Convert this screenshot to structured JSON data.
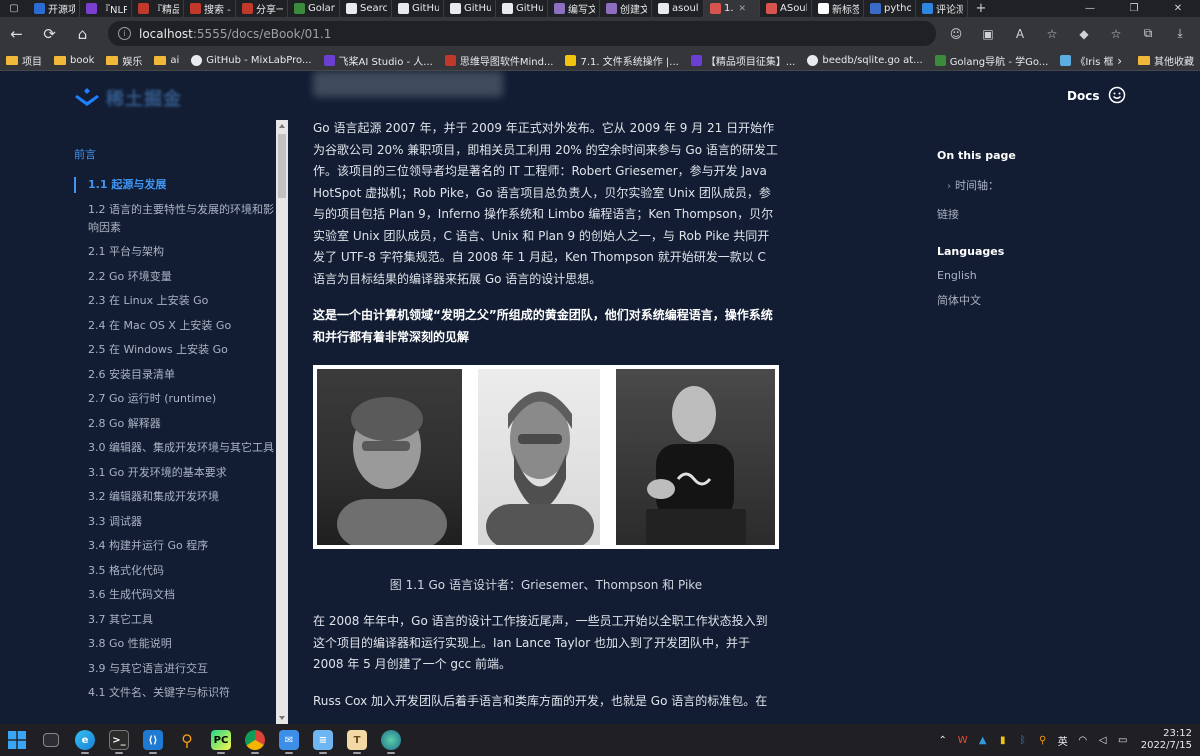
{
  "browser": {
    "tabs": [
      {
        "title": "开源项",
        "color": "#2b6cd4"
      },
      {
        "title": "『NLP",
        "color": "#7a3fd0"
      },
      {
        "title": "『精品",
        "color": "#c0392b"
      },
      {
        "title": "搜索 -",
        "color": "#c0392b"
      },
      {
        "title": "分享一",
        "color": "#c0392b"
      },
      {
        "title": "Golang",
        "color": "#3c8b3c"
      },
      {
        "title": "Search",
        "color": "#e8eaed"
      },
      {
        "title": "GitHub",
        "color": "#e8eaed"
      },
      {
        "title": "GitHub",
        "color": "#e8eaed"
      },
      {
        "title": "GitHub",
        "color": "#e8eaed"
      },
      {
        "title": "编写文",
        "color": "#8e6fbf"
      },
      {
        "title": "创建文",
        "color": "#8e6fbf"
      },
      {
        "title": "asoul",
        "color": "#e8eaed"
      },
      {
        "title": "1.",
        "color": "#d9534f"
      },
      {
        "title": "ASoul",
        "color": "#d9534f"
      },
      {
        "title": "新标签",
        "color": "#ffffff"
      },
      {
        "title": "python",
        "color": "#3b6bc9"
      },
      {
        "title": "评论测",
        "color": "#2e86de"
      }
    ],
    "url_host": "localhost",
    "url_path": ":5555/docs/eBook/01.1",
    "bookmarks": [
      {
        "label": "项目",
        "type": "folder"
      },
      {
        "label": "book",
        "type": "folder"
      },
      {
        "label": "娱乐",
        "type": "folder"
      },
      {
        "label": "ai",
        "type": "folder"
      },
      {
        "label": "GitHub - MixLabPro...",
        "type": "gh"
      },
      {
        "label": "飞桨AI Studio - 人...",
        "type": "sq",
        "color": "#6a3fd1"
      },
      {
        "label": "思维导图软件Mind...",
        "type": "sq",
        "color": "#c0392b"
      },
      {
        "label": "7.1. 文件系统操作 |...",
        "type": "sq",
        "color": "#f1c40f"
      },
      {
        "label": "【精品项目征集】...",
        "type": "sq",
        "color": "#6a3fd1"
      },
      {
        "label": "beedb/sqlite.go at...",
        "type": "gh"
      },
      {
        "label": "Golang导航 - 学Go...",
        "type": "sq",
        "color": "#3c8b3c"
      },
      {
        "label": "《Iris 框架中文文档...",
        "type": "sq",
        "color": "#5dade2"
      }
    ],
    "other_bookmarks": "其他收藏"
  },
  "site": {
    "name": "稀土掘金",
    "docs_label": "Docs"
  },
  "sidebar": {
    "section": "前言",
    "items": [
      {
        "label": "1.1 起源与发展",
        "active": true
      },
      {
        "label": "1.2 语言的主要特性与发展的环境和影响因素"
      },
      {
        "label": "2.1 平台与架构"
      },
      {
        "label": "2.2 Go 环境变量"
      },
      {
        "label": "2.3 在 Linux 上安装 Go"
      },
      {
        "label": "2.4 在 Mac OS X 上安装 Go"
      },
      {
        "label": "2.5 在 Windows 上安装 Go"
      },
      {
        "label": "2.6 安装目录清单"
      },
      {
        "label": "2.7 Go 运行时 (runtime)"
      },
      {
        "label": "2.8 Go 解释器"
      },
      {
        "label": "3.0 编辑器、集成开发环境与其它工具"
      },
      {
        "label": "3.1 Go 开发环境的基本要求"
      },
      {
        "label": "3.2 编辑器和集成开发环境"
      },
      {
        "label": "3.3 调试器"
      },
      {
        "label": "3.4 构建并运行 Go 程序"
      },
      {
        "label": "3.5 格式化代码"
      },
      {
        "label": "3.6 生成代码文档"
      },
      {
        "label": "3.7 其它工具"
      },
      {
        "label": "3.8 Go 性能说明"
      },
      {
        "label": "3.9 与其它语言进行交互"
      },
      {
        "label": "4.1 文件名、关键字与标识符"
      }
    ]
  },
  "content": {
    "para1": "Go 语言起源 2007 年，并于 2009 年正式对外发布。它从 2009 年 9 月 21 日开始作为谷歌公司 20% 兼职项目，即相关员工利用 20% 的空余时间来参与 Go 语言的研发工作。该项目的三位领导者均是著名的 IT 工程师：Robert Griesemer，参与开发 Java HotSpot 虚拟机；Rob Pike，Go 语言项目总负责人，贝尔实验室 Unix 团队成员，参与的项目包括 Plan 9，Inferno 操作系统和 Limbo 编程语言；Ken Thompson，贝尔实验室 Unix 团队成员，C 语言、Unix 和 Plan 9 的创始人之一，与 Rob Pike 共同开发了 UTF-8 字符集规范。自 2008 年 1 月起，Ken Thompson 就开始研发一款以 C 语言为目标结果的编译器来拓展 Go 语言的设计思想。",
    "para2": "这是一个由计算机领域“发明之父”所组成的黄金团队，他们对系统编程语言，操作系统和并行都有着非常深刻的见解",
    "caption": "图 1.1 Go 语言设计者：Griesemer、Thompson 和 Pike",
    "para3": "在 2008 年年中，Go 语言的设计工作接近尾声，一些员工开始以全职工作状态投入到这个项目的编译器和运行实现上。Ian Lance Taylor 也加入到了开发团队中，并于 2008 年 5 月创建了一个 gcc 前端。",
    "para4": "Russ Cox 加入开发团队后着手语言和类库方面的开发，也就是 Go 语言的标准包。在"
  },
  "toc": {
    "title": "On this page",
    "items": [
      "时间轴：",
      "链接"
    ],
    "languages_title": "Languages",
    "languages": [
      "English",
      "简体中文"
    ]
  },
  "taskbar": {
    "ime": "英",
    "time": "23:12",
    "date": "2022/7/15"
  }
}
